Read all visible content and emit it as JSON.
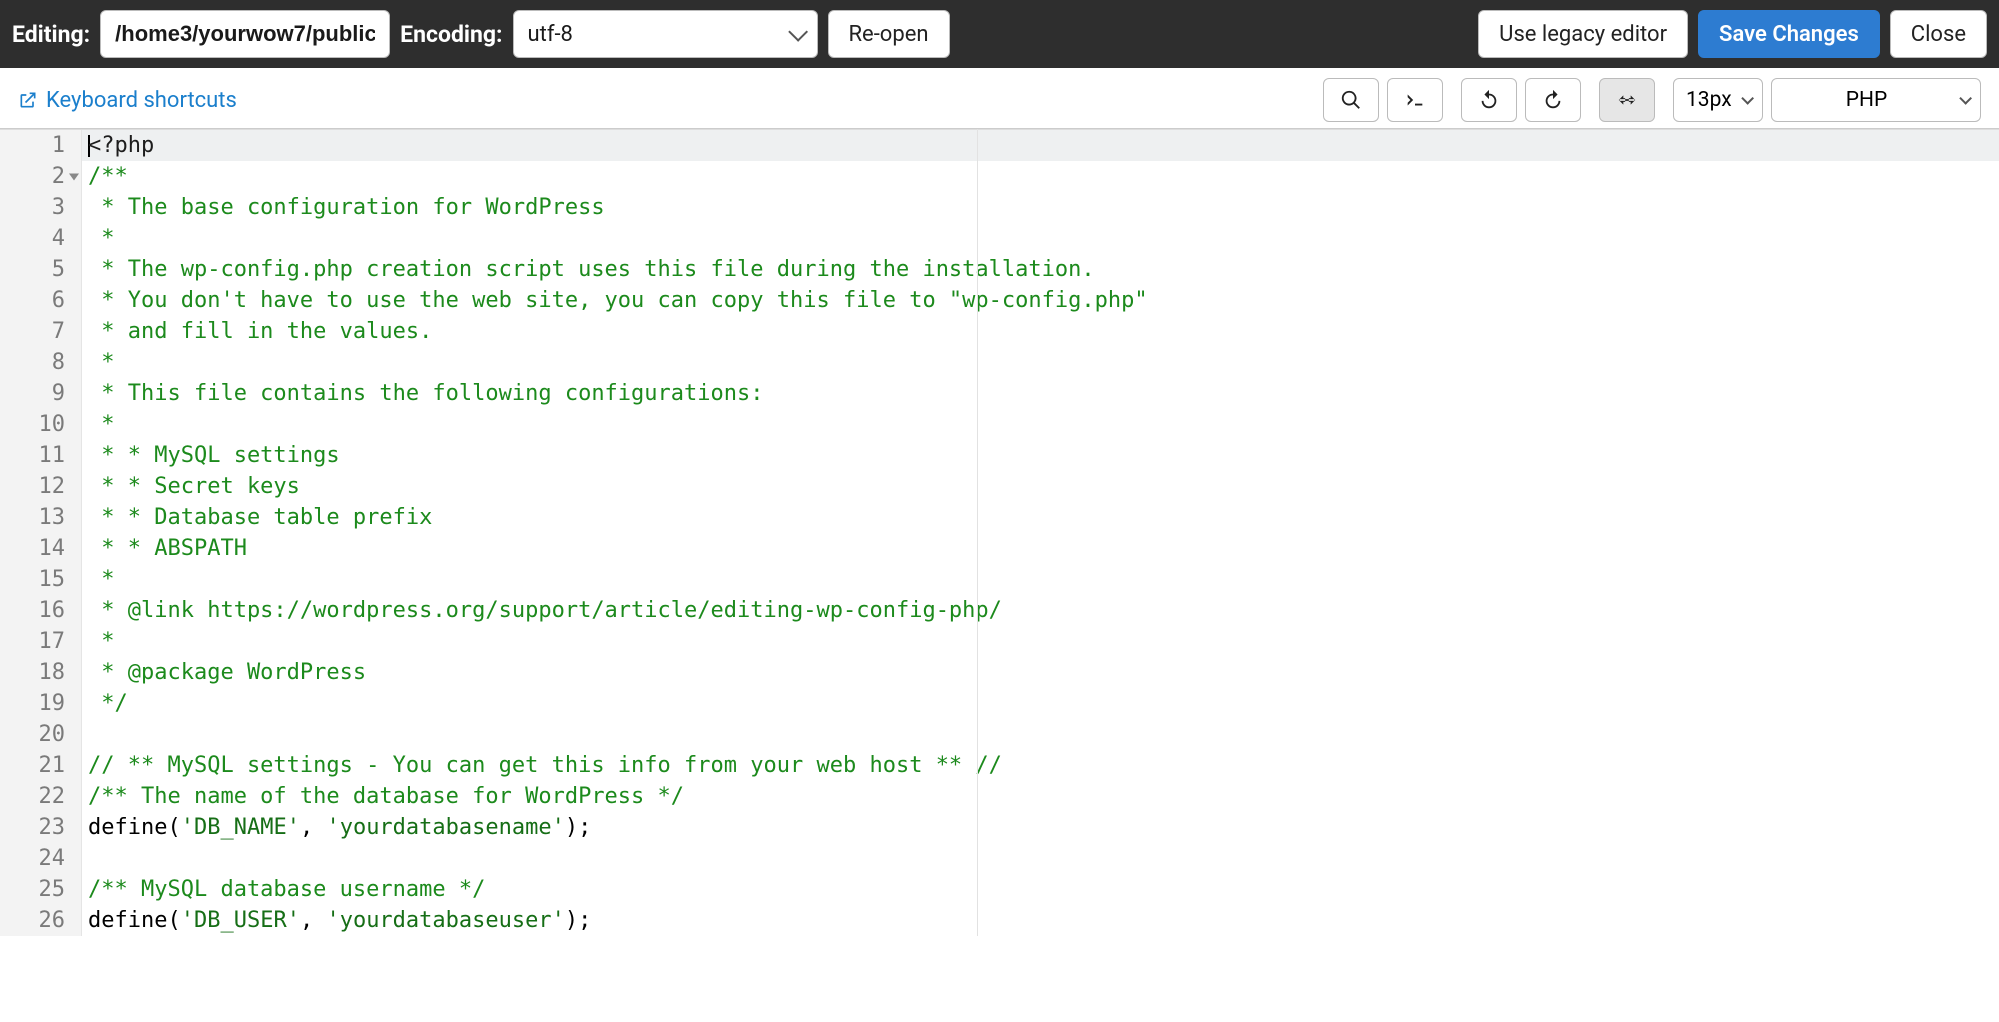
{
  "topbar": {
    "editing_label": "Editing:",
    "path_value": "/home3/yourwow7/public",
    "encoding_label": "Encoding:",
    "encoding_value": "utf-8",
    "reopen_label": "Re-open",
    "legacy_label": "Use legacy editor",
    "save_label": "Save Changes",
    "close_label": "Close"
  },
  "toolbar": {
    "keyboard_shortcuts": "Keyboard shortcuts",
    "font_size": "13px",
    "language": "PHP"
  },
  "code_lines": [
    {
      "n": 1,
      "fold": false,
      "current": true,
      "parts": [
        {
          "t": "<?php",
          "c": "tag"
        }
      ]
    },
    {
      "n": 2,
      "fold": true,
      "parts": [
        {
          "t": "/**",
          "c": "comment"
        }
      ]
    },
    {
      "n": 3,
      "parts": [
        {
          "t": " * The base configuration for WordPress",
          "c": "comment"
        }
      ]
    },
    {
      "n": 4,
      "parts": [
        {
          "t": " *",
          "c": "comment"
        }
      ]
    },
    {
      "n": 5,
      "parts": [
        {
          "t": " * The wp-config.php creation script uses this file during the installation.",
          "c": "comment"
        }
      ]
    },
    {
      "n": 6,
      "parts": [
        {
          "t": " * You don't have to use the web site, you can copy this file to \"wp-config.php\"",
          "c": "comment"
        }
      ]
    },
    {
      "n": 7,
      "parts": [
        {
          "t": " * and fill in the values.",
          "c": "comment"
        }
      ]
    },
    {
      "n": 8,
      "parts": [
        {
          "t": " *",
          "c": "comment"
        }
      ]
    },
    {
      "n": 9,
      "parts": [
        {
          "t": " * This file contains the following configurations:",
          "c": "comment"
        }
      ]
    },
    {
      "n": 10,
      "parts": [
        {
          "t": " *",
          "c": "comment"
        }
      ]
    },
    {
      "n": 11,
      "parts": [
        {
          "t": " * * MySQL settings",
          "c": "comment"
        }
      ]
    },
    {
      "n": 12,
      "parts": [
        {
          "t": " * * Secret keys",
          "c": "comment"
        }
      ]
    },
    {
      "n": 13,
      "parts": [
        {
          "t": " * * Database table prefix",
          "c": "comment"
        }
      ]
    },
    {
      "n": 14,
      "parts": [
        {
          "t": " * * ABSPATH",
          "c": "comment"
        }
      ]
    },
    {
      "n": 15,
      "parts": [
        {
          "t": " *",
          "c": "comment"
        }
      ]
    },
    {
      "n": 16,
      "parts": [
        {
          "t": " * @link https://wordpress.org/support/article/editing-wp-config-php/",
          "c": "comment"
        }
      ]
    },
    {
      "n": 17,
      "parts": [
        {
          "t": " *",
          "c": "comment"
        }
      ]
    },
    {
      "n": 18,
      "parts": [
        {
          "t": " * @package WordPress",
          "c": "comment"
        }
      ]
    },
    {
      "n": 19,
      "parts": [
        {
          "t": " */",
          "c": "comment"
        }
      ]
    },
    {
      "n": 20,
      "parts": [
        {
          "t": "",
          "c": ""
        }
      ]
    },
    {
      "n": 21,
      "parts": [
        {
          "t": "// ** MySQL settings - You can get this info from your web host ** //",
          "c": "comment"
        }
      ]
    },
    {
      "n": 22,
      "parts": [
        {
          "t": "/** The name of the database for WordPress */",
          "c": "comment"
        }
      ]
    },
    {
      "n": 23,
      "parts": [
        {
          "t": "define",
          "c": "fn"
        },
        {
          "t": "(",
          "c": "paren"
        },
        {
          "t": "'DB_NAME'",
          "c": "str"
        },
        {
          "t": ", ",
          "c": ""
        },
        {
          "t": "'yourdatabasename'",
          "c": "str"
        },
        {
          "t": ");",
          "c": "paren"
        }
      ]
    },
    {
      "n": 24,
      "parts": [
        {
          "t": "",
          "c": ""
        }
      ]
    },
    {
      "n": 25,
      "parts": [
        {
          "t": "/** MySQL database username */",
          "c": "comment"
        }
      ]
    },
    {
      "n": 26,
      "parts": [
        {
          "t": "define",
          "c": "fn"
        },
        {
          "t": "(",
          "c": "paren"
        },
        {
          "t": "'DB_USER'",
          "c": "str"
        },
        {
          "t": ", ",
          "c": ""
        },
        {
          "t": "'yourdatabaseuser'",
          "c": "str"
        },
        {
          "t": ");",
          "c": "paren"
        }
      ]
    }
  ]
}
